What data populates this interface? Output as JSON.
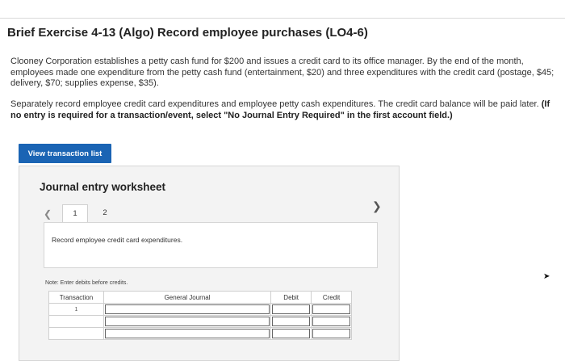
{
  "title": "Brief Exercise 4-13 (Algo) Record employee purchases (LO4-6)",
  "paragraph1": "Clooney Corporation establishes a petty cash fund for $200 and issues a credit card to its office manager. By the end of the month, employees made one expenditure from the petty cash fund (entertainment, $20) and three expenditures with the credit card (postage, $45; delivery, $70; supplies expense, $35).",
  "paragraph2": {
    "text": "Separately record employee credit card expenditures and employee petty cash expenditures. The credit card balance will be paid later. ",
    "bold": "(If no entry is required for a transaction/event, select \"No Journal Entry Required\" in the first account field.)"
  },
  "view_button_label": "View transaction list",
  "worksheet": {
    "title": "Journal entry worksheet",
    "tabs": [
      "1",
      "2"
    ],
    "instruction": "Record employee credit card expenditures.",
    "note": "Note: Enter debits before credits.",
    "table": {
      "headers": [
        "Transaction",
        "General Journal",
        "Debit",
        "Credit"
      ],
      "rows": [
        {
          "transaction": "1"
        },
        {
          "transaction": ""
        },
        {
          "transaction": ""
        }
      ]
    }
  },
  "icons": {
    "prev": "chevron-left-icon",
    "next": "chevron-right-icon"
  }
}
